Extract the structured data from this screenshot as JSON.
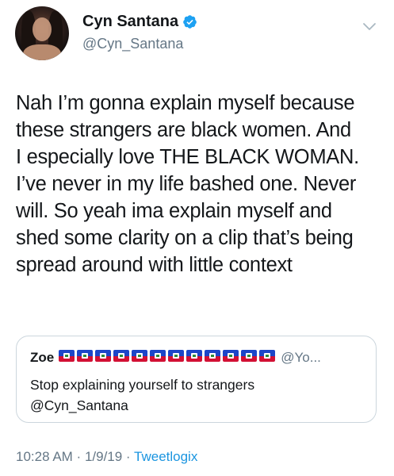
{
  "author": {
    "display_name": "Cyn Santana",
    "handle": "@Cyn_Santana",
    "verified": true
  },
  "tweet": {
    "lines": [
      "Nah I’m gonna explain myself because",
      "these strangers are black women. And",
      "I especially love THE BLACK WOMAN.",
      "I’ve never in my life bashed one. Never",
      "will. So yeah ima explain myself and",
      "shed some clarity on a clip that’s being",
      "spread around with little context"
    ]
  },
  "quoted_tweet": {
    "display_name": "Zoe",
    "flag_emoji_count": 12,
    "flag_icon": "haiti-flag-icon",
    "handle": "@Yo...",
    "lines": [
      "Stop explaining yourself to strangers",
      "@Cyn_Santana"
    ]
  },
  "meta": {
    "time": "10:28 AM",
    "separator1": " · ",
    "date": "1/9/19",
    "separator2": " · ",
    "source": "Tweetlogix"
  },
  "colors": {
    "text": "#14171a",
    "secondary": "#657786",
    "link": "#1b95e0",
    "verified": "#1da1f2",
    "border": "#ccd6dd"
  },
  "icons": {
    "verified": "verified-badge-icon",
    "menu": "chevron-down-icon"
  }
}
